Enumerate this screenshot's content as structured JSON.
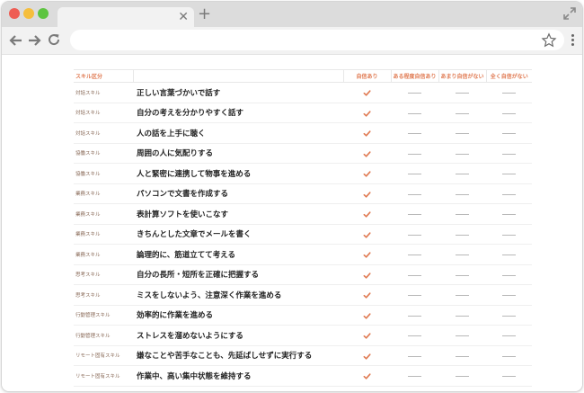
{
  "browser": {
    "address_value": "",
    "colors": {
      "tabbar": "#dcdcdc",
      "toolbar": "#f2f2f2"
    },
    "icons": [
      "close-icon",
      "plus-icon",
      "expand-icon",
      "back-arrow-icon",
      "forward-arrow-icon",
      "reload-icon",
      "star-icon",
      "menu-icon"
    ]
  },
  "table": {
    "accent_color": "#e07a52",
    "headers": {
      "category": "スキル区分",
      "skill": "",
      "levels": [
        "自信あり",
        "ある程度自信あり",
        "あまり自信がない",
        "全く自信がない"
      ]
    },
    "rows": [
      {
        "category": "対話スキル",
        "skill": "正しい言葉づかいで話す",
        "level": 0
      },
      {
        "category": "対話スキル",
        "skill": "自分の考えを分かりやすく話す",
        "level": 0
      },
      {
        "category": "対話スキル",
        "skill": "人の話を上手に聴く",
        "level": 0
      },
      {
        "category": "協働スキル",
        "skill": "周囲の人に気配りする",
        "level": 0
      },
      {
        "category": "協働スキル",
        "skill": "人と緊密に連携して物事を進める",
        "level": 0
      },
      {
        "category": "業務スキル",
        "skill": "パソコンで文書を作成する",
        "level": 0
      },
      {
        "category": "業務スキル",
        "skill": "表計算ソフトを使いこなす",
        "level": 0
      },
      {
        "category": "業務スキル",
        "skill": "きちんとした文章でメールを書く",
        "level": 0
      },
      {
        "category": "業務スキル",
        "skill": "論理的に、筋道立てて考える",
        "level": 0
      },
      {
        "category": "思考スキル",
        "skill": "自分の長所・短所を正確に把握する",
        "level": 0
      },
      {
        "category": "思考スキル",
        "skill": "ミスをしないよう、注意深く作業を進める",
        "level": 0
      },
      {
        "category": "行動管理スキル",
        "skill": "効率的に作業を進める",
        "level": 0
      },
      {
        "category": "行動管理スキル",
        "skill": "ストレスを溜めないようにする",
        "level": 0
      },
      {
        "category": "リモート固有スキル",
        "skill": "嫌なことや苦手なことも、先延ばしせずに実行する",
        "level": 0
      },
      {
        "category": "リモート固有スキル",
        "skill": "作業中、高い集中状態を維持する",
        "level": 0
      }
    ]
  }
}
